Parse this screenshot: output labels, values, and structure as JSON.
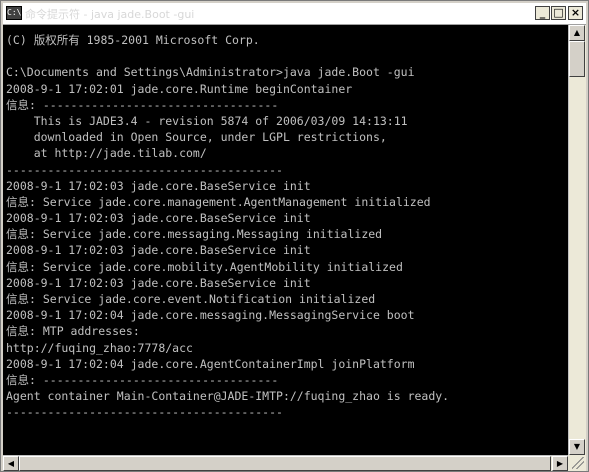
{
  "window": {
    "title": "命令提示符 - java  jade.Boot -gui",
    "icon_label": "C:\\"
  },
  "controls": {
    "minimize": "_",
    "maximize": "□",
    "close": "×"
  },
  "console": {
    "lines": [
      "(C) 版权所有 1985-2001 Microsoft Corp.",
      "",
      "C:\\Documents and Settings\\Administrator>java jade.Boot -gui",
      "2008-9-1 17:02:01 jade.core.Runtime beginContainer",
      "信息: ----------------------------------",
      "    This is JADE3.4 - revision 5874 of 2006/03/09 14:13:11",
      "    downloaded in Open Source, under LGPL restrictions,",
      "    at http://jade.tilab.com/",
      "----------------------------------------",
      "2008-9-1 17:02:03 jade.core.BaseService init",
      "信息: Service jade.core.management.AgentManagement initialized",
      "2008-9-1 17:02:03 jade.core.BaseService init",
      "信息: Service jade.core.messaging.Messaging initialized",
      "2008-9-1 17:02:03 jade.core.BaseService init",
      "信息: Service jade.core.mobility.AgentMobility initialized",
      "2008-9-1 17:02:03 jade.core.BaseService init",
      "信息: Service jade.core.event.Notification initialized",
      "2008-9-1 17:02:04 jade.core.messaging.MessagingService boot",
      "信息: MTP addresses:",
      "http://fuqing_zhao:7778/acc",
      "2008-9-1 17:02:04 jade.core.AgentContainerImpl joinPlatform",
      "信息: ----------------------------------",
      "Agent container Main-Container@JADE-IMTP://fuqing_zhao is ready.",
      "----------------------------------------"
    ]
  },
  "scrollbars": {
    "up_arrow": "▲",
    "down_arrow": "▼",
    "left_arrow": "◀",
    "right_arrow": "▶"
  },
  "colors": {
    "console_bg": "#000000",
    "console_text": "#c0c0c0",
    "chrome": "#d4d0c8"
  }
}
